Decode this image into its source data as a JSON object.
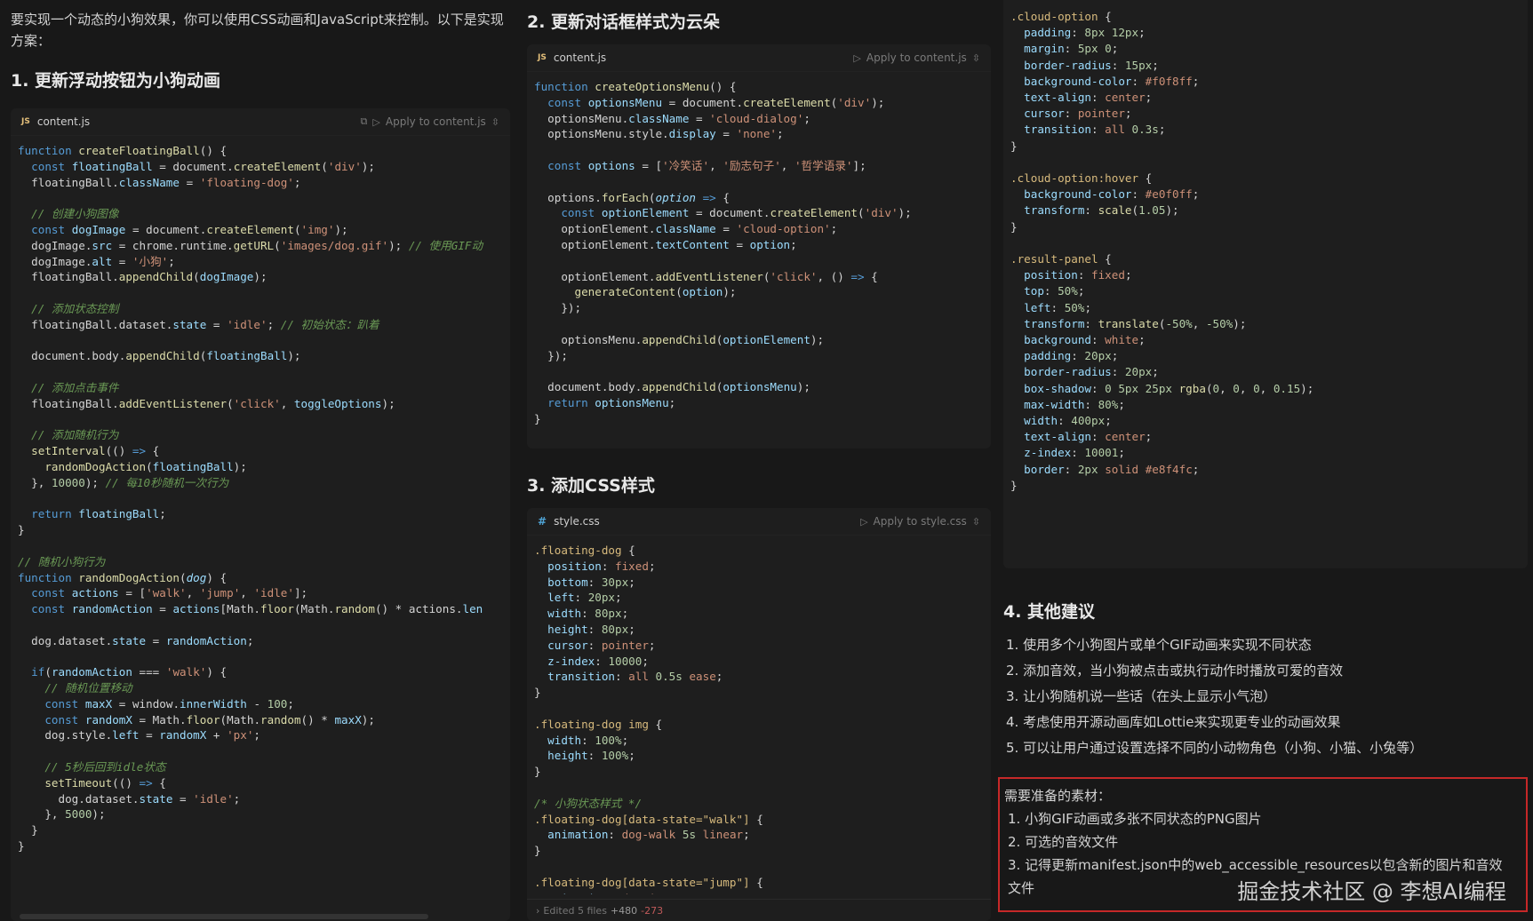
{
  "intro": "要实现一个动态的小狗效果，你可以使用CSS动画和JavaScript来控制。以下是实现方案：",
  "sections": {
    "s1": "1. 更新浮动按钮为小狗动画",
    "s2": "2. 更新对话框样式为云朵",
    "s3": "3. 添加CSS样式",
    "s4": "4. 其他建议"
  },
  "code_blocks": {
    "b1": {
      "lang": "JS",
      "file": "content.js",
      "apply": "Apply to content.js"
    },
    "b2": {
      "lang": "JS",
      "file": "content.js",
      "apply": "Apply to content.js"
    },
    "b3": {
      "lang": "#",
      "file": "style.css",
      "apply": "Apply to style.css",
      "edited": "Edited 5 files",
      "added": "+480",
      "removed": "-273"
    }
  },
  "suggestions": [
    "1. 使用多个小狗图片或单个GIF动画来实现不同状态",
    "2. 添加音效，当小狗被点击或执行动作时播放可爱的音效",
    "3. 让小狗随机说一些话（在头上显示小气泡）",
    "4. 考虑使用开源动画库如Lottie来实现更专业的动画效果",
    "5. 可以让用户通过设置选择不同的小动物角色（小狗、小猫、小兔等）"
  ],
  "materials": {
    "title": "需要准备的素材：",
    "items": [
      "1. 小狗GIF动画或多张不同状态的PNG图片",
      "2. 可选的音效文件",
      "3. 记得更新manifest.json中的web_accessible_resources以包含新的图片和音效文件"
    ]
  },
  "watermark": "掘金技术社区 @ 李想AI编程",
  "icons": {
    "js": "js-file-icon",
    "css": "css-file-icon",
    "copy": "copy-icon",
    "play": "play-icon",
    "expand": "chevron-updown-icon"
  }
}
